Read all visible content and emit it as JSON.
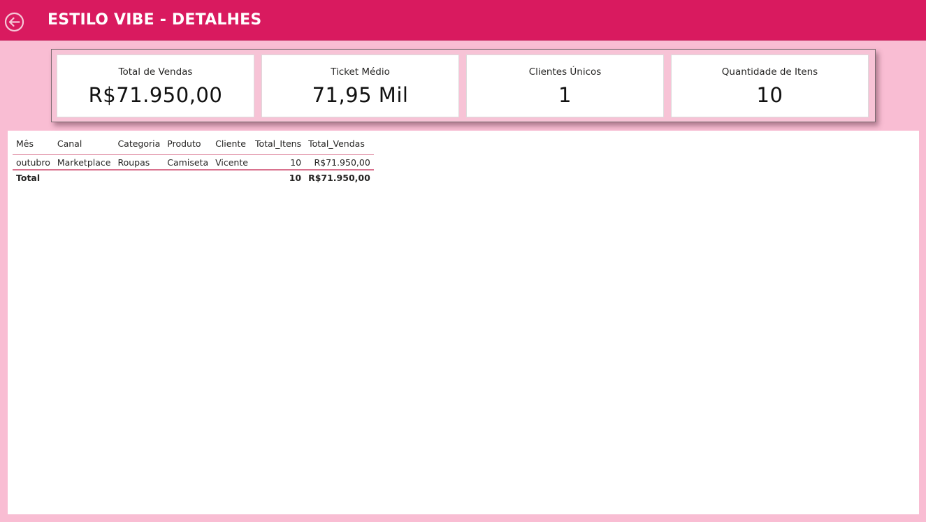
{
  "header": {
    "title": "ESTILO VIBE - DETALHES",
    "back_icon": "arrow-left-circle-icon",
    "background": "#d91a5f"
  },
  "kpis": [
    {
      "label": "Total de Vendas",
      "value": "R$71.950,00"
    },
    {
      "label": "Ticket Médio",
      "value": "71,95 Mil"
    },
    {
      "label": "Clientes Únicos",
      "value": "1"
    },
    {
      "label": "Quantidade de Itens",
      "value": "10"
    }
  ],
  "table": {
    "columns": [
      "Mês",
      "Canal",
      "Categoria",
      "Produto",
      "Cliente",
      "Total_Itens",
      "Total_Vendas"
    ],
    "rows": [
      [
        "outubro",
        "Marketplace",
        "Roupas",
        "Camiseta",
        "Vicente",
        "10",
        "R$71.950,00"
      ]
    ],
    "total": {
      "label": "Total",
      "total_itens": "10",
      "total_vendas": "R$71.950,00"
    }
  },
  "colors": {
    "accent": "#d91a5f",
    "page_background": "#f9bdd3",
    "table_line": "#d9738f"
  }
}
